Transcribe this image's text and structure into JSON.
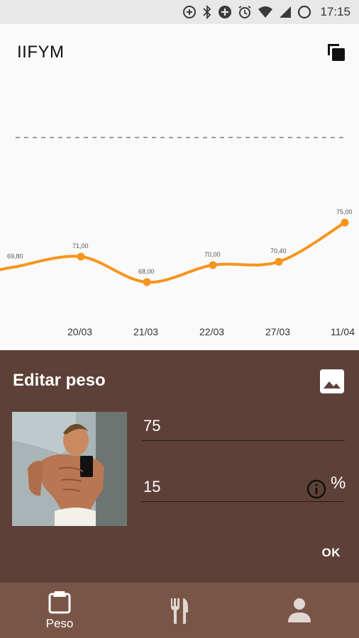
{
  "status_bar": {
    "time": "17:15",
    "icons": [
      "data-saver-icon",
      "bluetooth-icon",
      "add-circle-icon",
      "alarm-icon",
      "wifi-icon",
      "signal-icon",
      "battery-icon"
    ]
  },
  "app_bar": {
    "title": "IIFYM",
    "action_icon": "copy-icon"
  },
  "chart_data": {
    "type": "line",
    "categories": [
      "",
      "20/03",
      "21/03",
      "22/03",
      "27/03",
      "11/04"
    ],
    "values": [
      69.8,
      71.0,
      68.0,
      70.0,
      70.4,
      75.0
    ],
    "point_labels": [
      "69,80",
      "71,00",
      "68,00",
      "70,00",
      "70,40",
      "75,00"
    ],
    "target_line": 85,
    "ylim": [
      60,
      90
    ],
    "grid": false,
    "colors": {
      "line": "#f7941d",
      "target": "#9e9e9e"
    }
  },
  "editor": {
    "title": "Editar peso",
    "image_icon": "image-icon",
    "weight_value": "75",
    "fat_value": "15",
    "fat_unit": "%",
    "info_icon": "info-icon",
    "ok_label": "OK"
  },
  "bottom_nav": {
    "items": [
      {
        "label": "Peso",
        "icon": "scale-icon",
        "active": true
      },
      {
        "label": "",
        "icon": "restaurant-icon",
        "active": false
      },
      {
        "label": "",
        "icon": "person-icon",
        "active": false
      }
    ]
  },
  "colors": {
    "editor_bg": "#5d4037",
    "nav_bg": "#795548",
    "accent": "#f7941d"
  }
}
